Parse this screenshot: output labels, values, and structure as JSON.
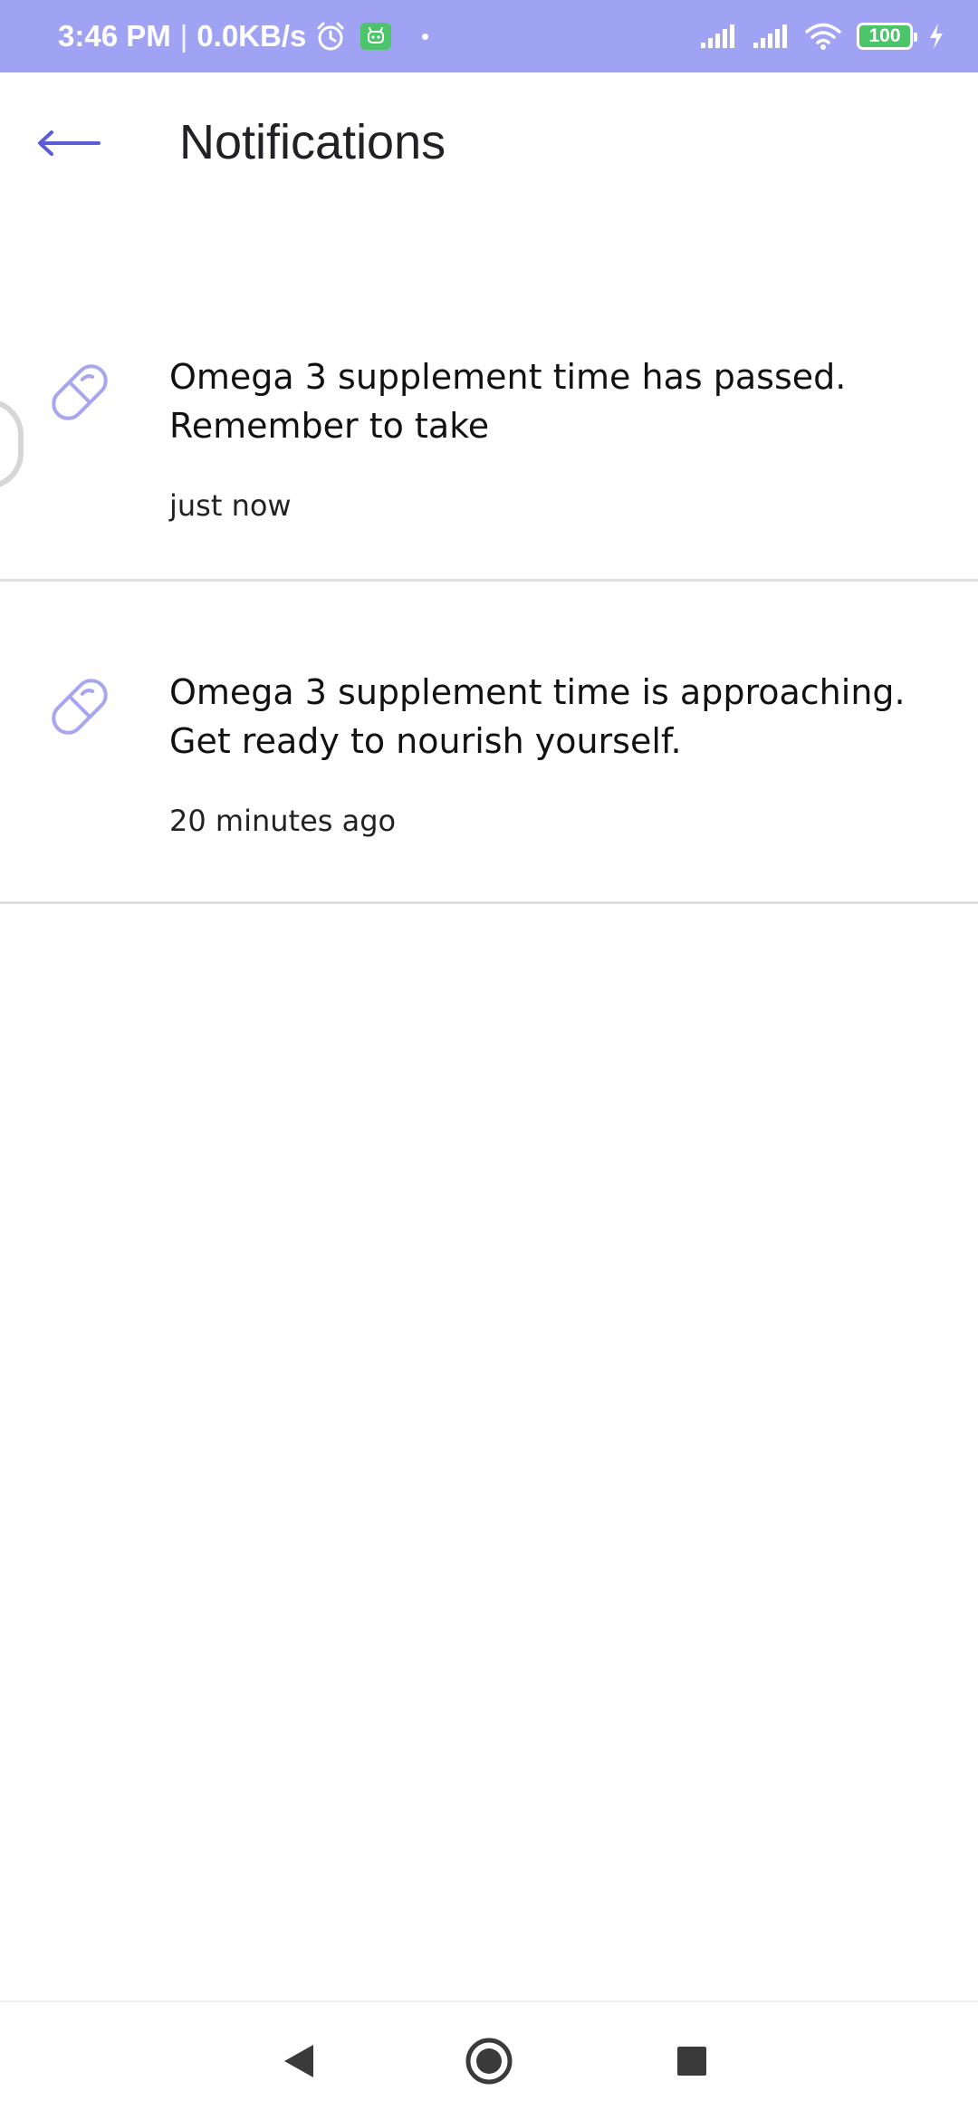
{
  "status_bar": {
    "time": "3:46 PM",
    "separator": "|",
    "network_speed": "0.0KB/s",
    "battery_level": "100",
    "icons": [
      "alarm-icon",
      "robot-badge-icon",
      "signal-icon",
      "signal-icon",
      "wifi-icon",
      "battery-icon",
      "charging-icon"
    ],
    "bar_color": "#a0a3f4"
  },
  "header": {
    "title": "Notifications",
    "back_icon": "arrow-left-icon"
  },
  "notifications": [
    {
      "icon": "pill-icon",
      "message": "Omega 3 supplement time has passed. Remember to take",
      "time": "just now"
    },
    {
      "icon": "pill-icon",
      "message": "Omega 3 supplement time is approaching. Get ready to nourish yourself.",
      "time": "20 minutes ago"
    }
  ],
  "nav_bar": {
    "icons": [
      "back-triangle-icon",
      "home-circle-icon",
      "recents-square-icon"
    ]
  },
  "colors": {
    "accent": "#6b6bdc",
    "icon_tint": "#a7a6ef",
    "divider": "#dedede"
  }
}
